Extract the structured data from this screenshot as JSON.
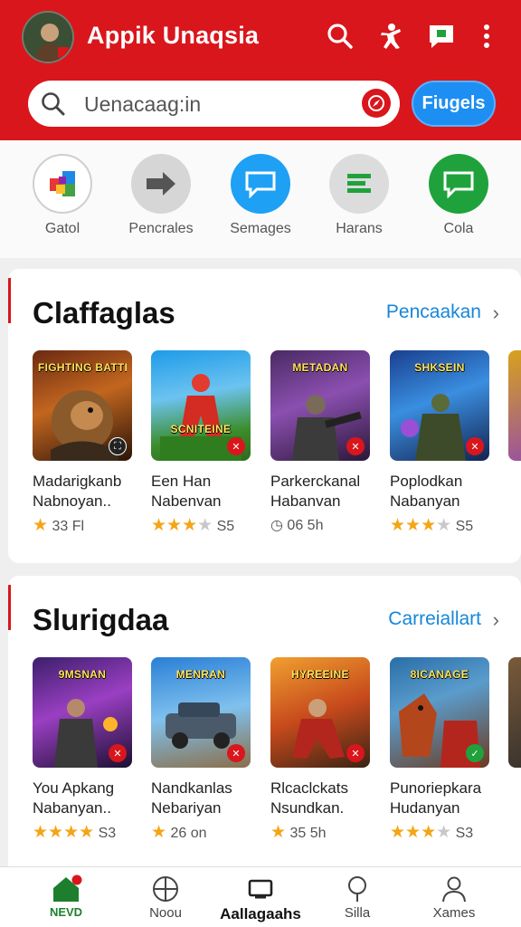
{
  "header": {
    "title": "Appik Unaqsia",
    "search_placeholder": "Uenacaag:in",
    "filter_label": "Fiugels",
    "icons": [
      "search-icon",
      "person-dance-icon",
      "message-icon",
      "more-vert-icon"
    ]
  },
  "categories": [
    {
      "label": "Gatol",
      "icon": "cube-icon",
      "color": "#ffffff"
    },
    {
      "label": "Pencrales",
      "icon": "arrow-icon",
      "color": "#d6d6d6"
    },
    {
      "label": "Semages",
      "icon": "chat-icon",
      "color": "#1ea0f5"
    },
    {
      "label": "Harans",
      "icon": "list-icon",
      "color": "#dcdcdc"
    },
    {
      "label": "Cola",
      "icon": "chat-icon",
      "color": "#1fa23c"
    }
  ],
  "sections": [
    {
      "title": "Claffaglas",
      "link": "Pencaakan",
      "cards": [
        {
          "line1": "Madarigkanb",
          "line2": "Nabnoyan..",
          "meta": "33 Fl",
          "stars": 1,
          "banner": "FIGHTING BATTLE"
        },
        {
          "line1": "Een Han",
          "line2": "Nabenvan",
          "meta": "S5",
          "stars": 3,
          "banner": "SCNITEINE"
        },
        {
          "line1": "Parkerckanal",
          "line2": "Habanvan",
          "meta": "06 5h",
          "stars": 0,
          "banner": "METADAN"
        },
        {
          "line1": "Poplodkan",
          "line2": "Nabanyan",
          "meta": "S5",
          "stars": 3,
          "banner": "SHKSEIN"
        }
      ]
    },
    {
      "title": "Slurigdaa",
      "link": "Carreiallart",
      "cards": [
        {
          "line1": "You Apkang",
          "line2": "Nabanyan..",
          "meta": "S3",
          "stars": 4,
          "banner": "9MSNAN"
        },
        {
          "line1": "Nandkanlas",
          "line2": "Nebariyan",
          "meta": "26 on",
          "stars": 1,
          "banner": "MENRAN"
        },
        {
          "line1": "Rlcaclckats",
          "line2": "Nsundkan.",
          "meta": "35 5h",
          "stars": 1,
          "banner": "HYREEINE"
        },
        {
          "line1": "Punoriepkara",
          "line2": "Hudanyan",
          "meta": "S3",
          "stars": 3,
          "banner": "8ICANAGE"
        }
      ]
    }
  ],
  "bottom_nav": [
    {
      "label": "NEVD",
      "icon": "home-icon",
      "active": true
    },
    {
      "label": "Noou",
      "icon": "globe-icon",
      "active": false
    },
    {
      "label": "Aallagaahs",
      "icon": "tablet-icon",
      "active": false
    },
    {
      "label": "Silla",
      "icon": "pin-icon",
      "active": false
    },
    {
      "label": "Xames",
      "icon": "person-icon",
      "active": false
    }
  ],
  "colors": {
    "brand": "#d9161c",
    "accent_blue": "#1d8ff2",
    "star": "#f4a515"
  }
}
